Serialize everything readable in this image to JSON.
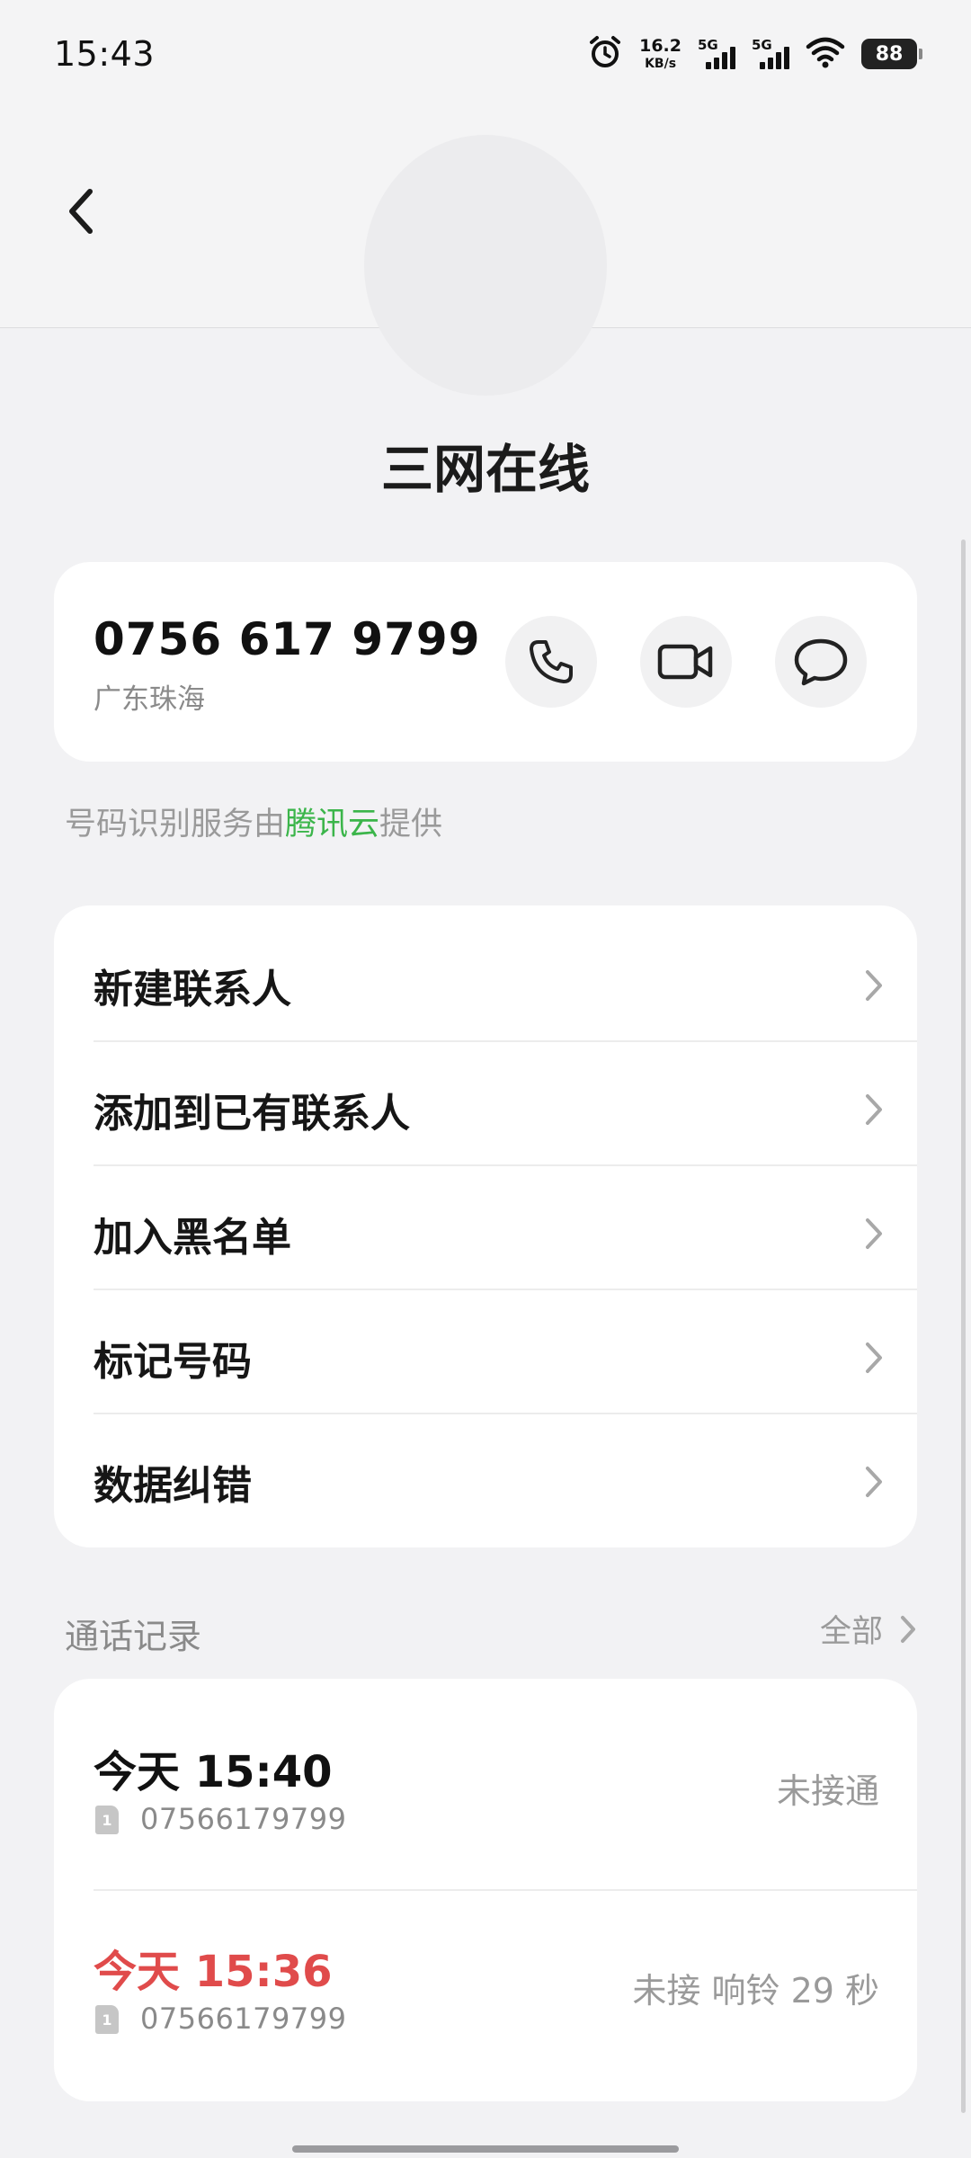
{
  "status_bar": {
    "time": "15:43",
    "net_speed_value": "16.2",
    "net_speed_unit": "KB/s",
    "sim1_label": "5G",
    "sim2_label": "5G",
    "battery": "88"
  },
  "contact": {
    "name": "三网在线",
    "number": "0756 617 9799",
    "location": "广东珠海"
  },
  "provider_note": {
    "prefix": "号码识别服务由",
    "brand": "腾讯云",
    "suffix": "提供"
  },
  "menu": [
    {
      "label": "新建联系人"
    },
    {
      "label": "添加到已有联系人"
    },
    {
      "label": "加入黑名单"
    },
    {
      "label": "标记号码"
    },
    {
      "label": "数据纠错"
    }
  ],
  "call_log": {
    "title": "通话记录",
    "all_label": "全部",
    "entries": [
      {
        "time": "今天 15:40",
        "sim": "1",
        "number": "07566179799",
        "status": "未接通",
        "missed": false
      },
      {
        "time": "今天 15:36",
        "sim": "1",
        "number": "07566179799",
        "status": "未接 响铃 29 秒",
        "missed": true
      }
    ]
  },
  "colors": {
    "background": "#f2f2f4",
    "card": "#ffffff",
    "brand_green": "#3bb54a",
    "missed_red": "#e04b4b",
    "muted_text": "#9a9a9a"
  },
  "icons": [
    "alarm-icon",
    "signal-icon",
    "wifi-icon",
    "battery-icon",
    "back-arrow-icon",
    "phone-icon",
    "video-call-icon",
    "message-icon",
    "chevron-right-icon",
    "sim-card-icon"
  ]
}
